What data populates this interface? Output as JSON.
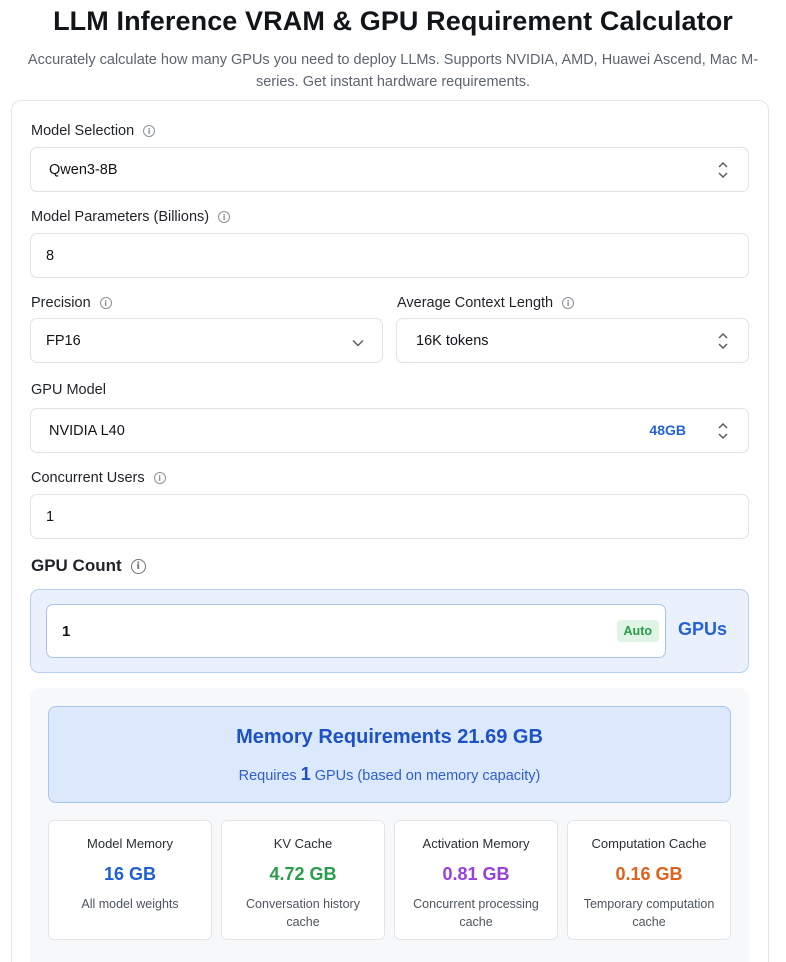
{
  "header": {
    "title": "LLM Inference VRAM & GPU Requirement Calculator",
    "subtitle": "Accurately calculate how many GPUs you need to deploy LLMs. Supports NVIDIA, AMD, Huawei Ascend, Mac M-series. Get instant hardware requirements."
  },
  "form": {
    "model_selection": {
      "label": "Model Selection",
      "value": "Qwen3-8B"
    },
    "model_parameters": {
      "label": "Model Parameters (Billions)",
      "value": "8"
    },
    "precision": {
      "label": "Precision",
      "value": "FP16"
    },
    "context_length": {
      "label": "Average Context Length",
      "value": "16K tokens"
    },
    "gpu_model": {
      "label": "GPU Model",
      "value": "NVIDIA L40",
      "memory": "48GB"
    },
    "concurrent_users": {
      "label": "Concurrent Users",
      "value": "1"
    },
    "gpu_count": {
      "label": "GPU Count",
      "value": "1",
      "auto_tag": "Auto",
      "unit": "GPUs"
    }
  },
  "results": {
    "memory_title": "Memory Requirements 21.69 GB",
    "requires_prefix": "Requires",
    "requires_count": "1",
    "requires_suffix": "GPUs (based on memory capacity)",
    "stats": [
      {
        "label": "Model Memory",
        "value": "16 GB",
        "desc": "All model weights",
        "color": "#1f5fd6"
      },
      {
        "label": "KV Cache",
        "value": "4.72 GB",
        "desc": "Conversation history cache",
        "color": "#2a9d4b"
      },
      {
        "label": "Activation Memory",
        "value": "0.81 GB",
        "desc": "Concurrent processing cache",
        "color": "#9b3fd9"
      },
      {
        "label": "Computation Cache",
        "value": "0.16 GB",
        "desc": "Temporary computation cache",
        "color": "#e0611c"
      }
    ]
  },
  "icons": [
    "info-icon",
    "updown-chevron-icon",
    "chevron-down-icon"
  ]
}
